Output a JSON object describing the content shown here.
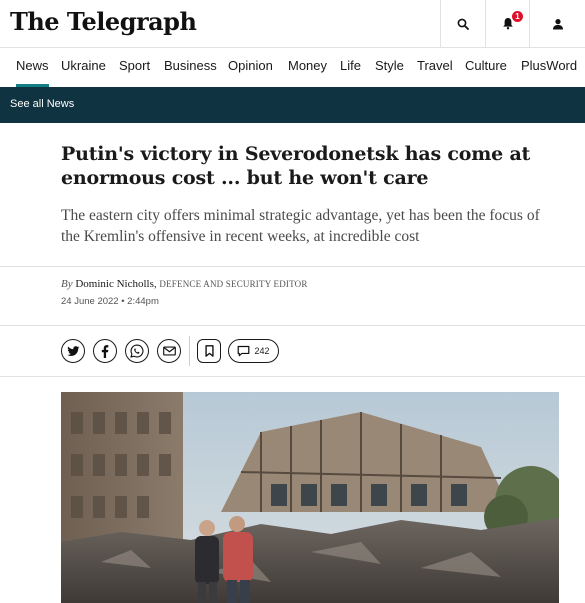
{
  "masthead": {
    "logo": "The Telegraph",
    "notification_count": "1"
  },
  "nav": {
    "items": [
      "News",
      "Ukraine",
      "Sport",
      "Business",
      "Opinion",
      "Money",
      "Life",
      "Style",
      "Travel",
      "Culture",
      "PlusWord"
    ],
    "active": "News"
  },
  "subbar": {
    "link": "See all News"
  },
  "article": {
    "headline": "Putin's victory in Severodonetsk has come at enormous cost ... but he won't care",
    "standfirst": "The eastern city offers minimal strategic advantage, yet has been the focus of the Kremlin's offensive in recent weeks, at incredible cost",
    "byline_prefix": "By",
    "author": "Dominic Nicholls,",
    "author_role": "DEFENCE AND SECURITY EDITOR",
    "date": "24 June 2022 • 2:44pm"
  },
  "share": {
    "comment_count": "242",
    "icons": [
      "twitter-icon",
      "facebook-icon",
      "whatsapp-icon",
      "email-icon",
      "bookmark-icon",
      "comment-icon"
    ]
  },
  "colors": {
    "accent": "#127e85",
    "subbar_bg": "#0f3340",
    "badge": "#e0102a"
  }
}
